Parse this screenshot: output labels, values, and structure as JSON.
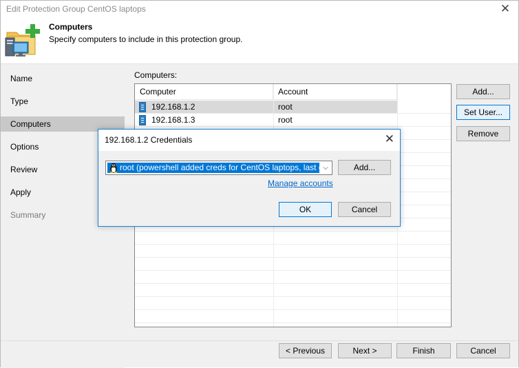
{
  "window": {
    "title": "Edit Protection Group CentOS laptops",
    "close_glyph": "✕"
  },
  "header": {
    "title": "Computers",
    "subtitle": "Specify computers to include in this protection group.",
    "icon": "protection-group-add-icon"
  },
  "sidebar": {
    "items": [
      {
        "label": "Name",
        "state": "normal"
      },
      {
        "label": "Type",
        "state": "normal"
      },
      {
        "label": "Computers",
        "state": "active"
      },
      {
        "label": "Options",
        "state": "normal"
      },
      {
        "label": "Review",
        "state": "normal"
      },
      {
        "label": "Apply",
        "state": "normal"
      },
      {
        "label": "Summary",
        "state": "disabled"
      }
    ]
  },
  "computers": {
    "label": "Computers:",
    "columns": [
      "Computer",
      "Account"
    ],
    "rows": [
      {
        "computer": "192.168.1.2",
        "account": "root",
        "selected": true
      },
      {
        "computer": "192.168.1.3",
        "account": "root",
        "selected": false
      }
    ]
  },
  "side_buttons": {
    "add": "Add...",
    "set_user": "Set User...",
    "remove": "Remove"
  },
  "footer": {
    "previous": "< Previous",
    "next": "Next >",
    "finish": "Finish",
    "cancel": "Cancel"
  },
  "dialog": {
    "title": "192.168.1.2 Credentials",
    "close_glyph": "✕",
    "credential_value": "root (powershell added creds for CentOS laptops, last edited",
    "add_label": "Add...",
    "manage_accounts": "Manage accounts",
    "ok": "OK",
    "cancel": "Cancel",
    "dropdown_glyph": "⌵"
  },
  "colors": {
    "accent": "#0078d7",
    "link": "#0066cc",
    "selected_row": "#d9d9d9",
    "active_nav": "#c8c8c8"
  }
}
